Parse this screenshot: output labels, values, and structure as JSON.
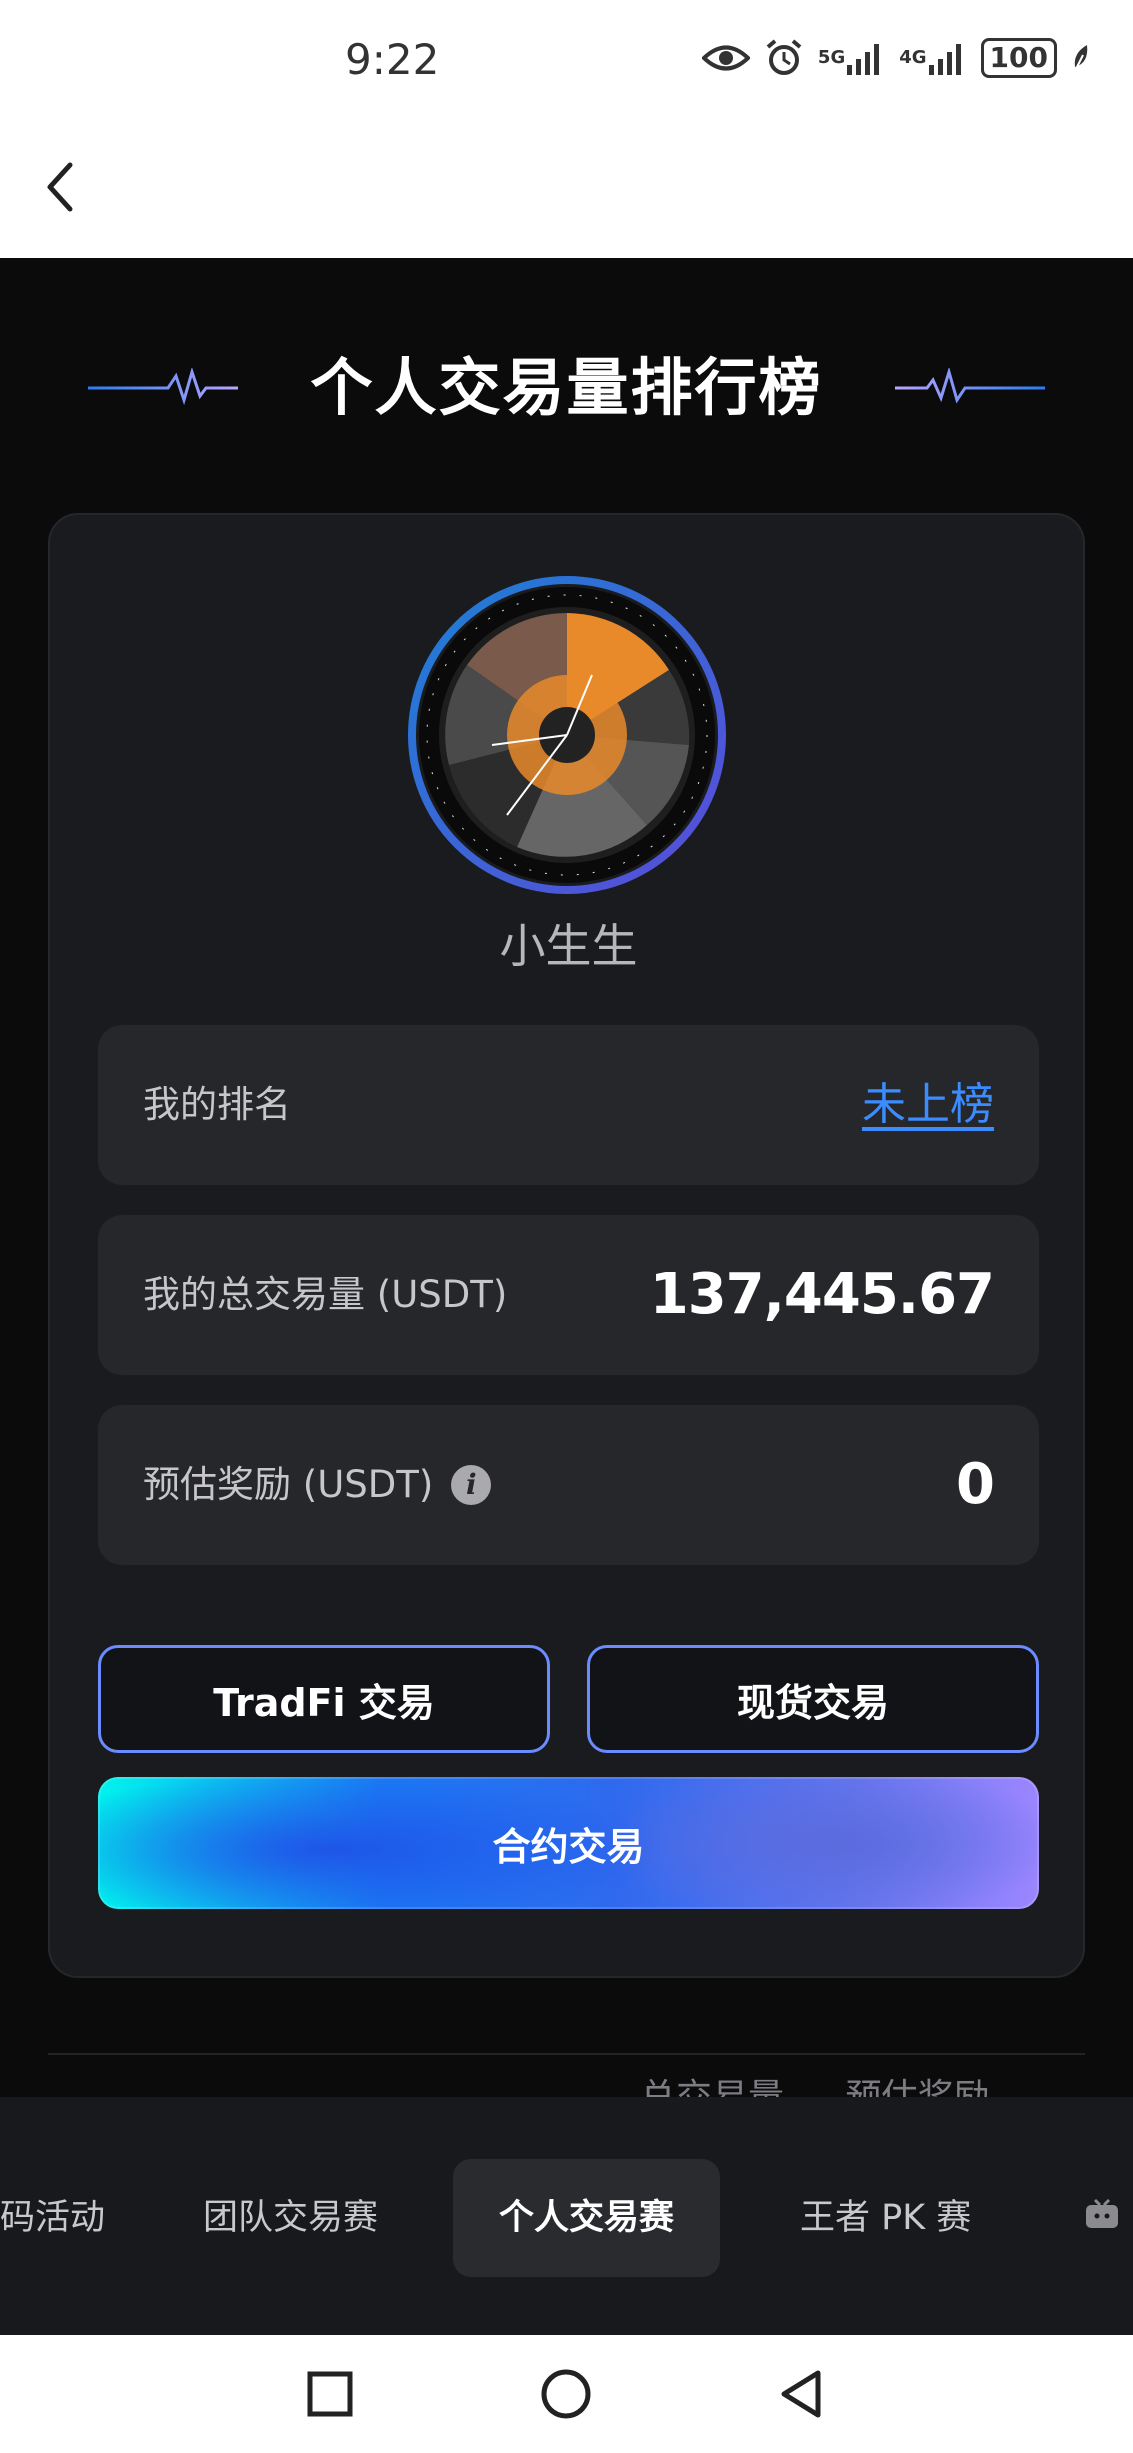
{
  "status_bar": {
    "time": "9:22",
    "net1": "5G",
    "net2": "4G",
    "battery": "100"
  },
  "page": {
    "title": "个人交易量排行榜"
  },
  "profile": {
    "username": "小生生"
  },
  "stats": {
    "rank_label": "我的排名",
    "rank_value": "未上榜",
    "volume_label": "我的总交易量 (USDT)",
    "volume_value": "137,445.67",
    "reward_label": "预估奖励 (USDT)",
    "reward_value": "0"
  },
  "actions": {
    "tradfi": "TradFi 交易",
    "spot": "现货交易",
    "futures": "合约交易"
  },
  "table_header_peek": [
    "总交易量",
    "预估奖励"
  ],
  "tabs": [
    {
      "label": "码活动"
    },
    {
      "label": "团队交易赛"
    },
    {
      "label": "个人交易赛"
    },
    {
      "label": "王者 PK 赛"
    }
  ],
  "colors": {
    "link": "#3b8cff",
    "accent_gradient_start": "#00f4ee",
    "accent_gradient_end": "#9c86ff"
  }
}
